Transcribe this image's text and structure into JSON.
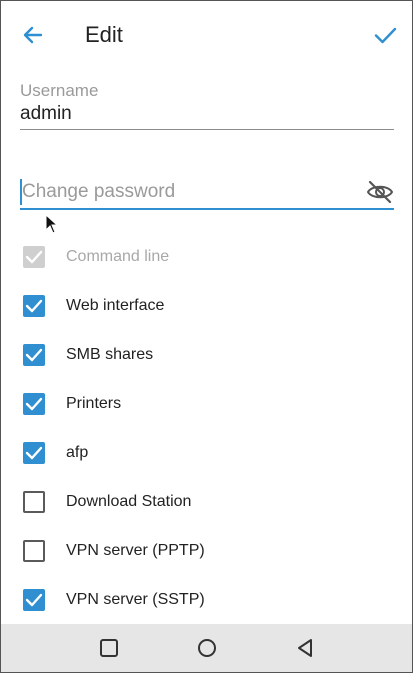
{
  "header": {
    "title": "Edit",
    "back_icon": "back-arrow-icon",
    "confirm_icon": "check-icon"
  },
  "username": {
    "label": "Username",
    "value": "admin"
  },
  "password": {
    "placeholder": "Change password",
    "value": "",
    "visibility_icon": "eye-off-icon"
  },
  "permissions": [
    {
      "label": "Command line",
      "checked": true,
      "disabled": true
    },
    {
      "label": "Web interface",
      "checked": true,
      "disabled": false
    },
    {
      "label": "SMB shares",
      "checked": true,
      "disabled": false
    },
    {
      "label": "Printers",
      "checked": true,
      "disabled": false
    },
    {
      "label": "afp",
      "checked": true,
      "disabled": false
    },
    {
      "label": "Download Station",
      "checked": false,
      "disabled": false
    },
    {
      "label": "VPN server (PPTP)",
      "checked": false,
      "disabled": false
    },
    {
      "label": "VPN server (SSTP)",
      "checked": true,
      "disabled": false
    }
  ],
  "navbar": {
    "icons": [
      "recents-square-icon",
      "home-circle-icon",
      "back-triangle-icon"
    ]
  },
  "colors": {
    "accent": "#2f8fd1",
    "disabled": "#cfcfcf",
    "navbar_bg": "#e6e6e6"
  }
}
